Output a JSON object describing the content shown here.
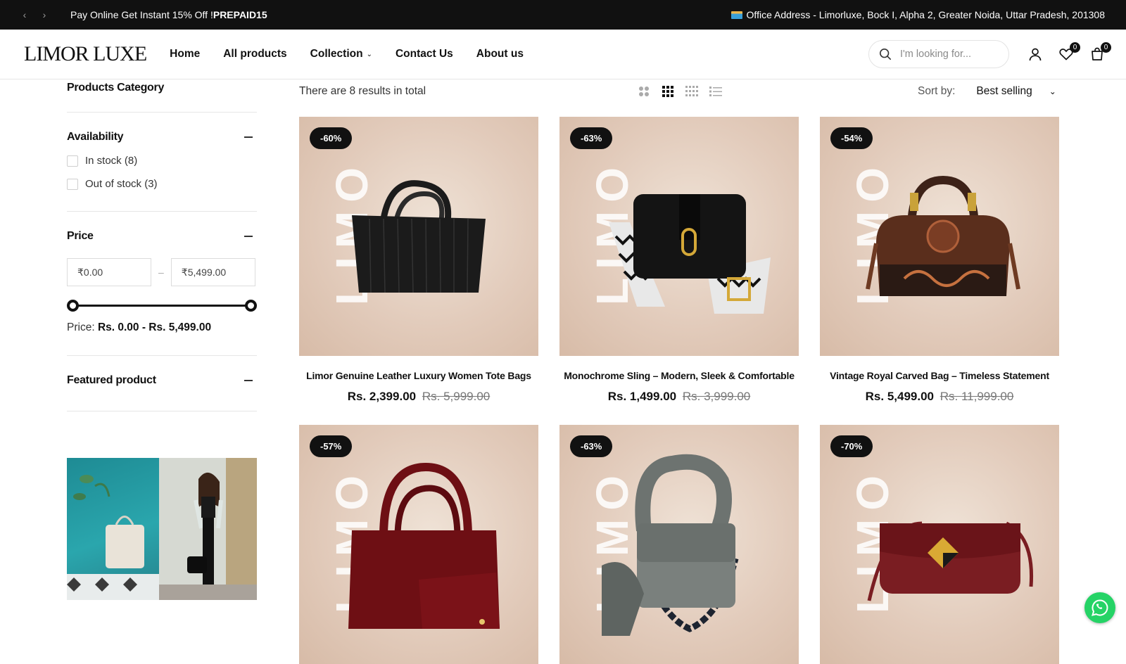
{
  "announcement": {
    "promo_text": "Pay Online Get Instant 15% Off !",
    "promo_code": "PREPAID15",
    "address": "Office Address - Limorluxe, Bock I, Alpha 2, Greater Noida, Uttar Pradesh, 201308"
  },
  "header": {
    "logo": "LIMOR LUXE",
    "nav": [
      "Home",
      "All products",
      "Collection",
      "Contact Us",
      "About us"
    ],
    "search_placeholder": "I'm looking for...",
    "wishlist_count": "0",
    "cart_count": "0"
  },
  "sidebar": {
    "category_title": "Products Category",
    "availability_title": "Availability",
    "in_stock": "In stock (8)",
    "out_of_stock": "Out of stock (3)",
    "price_title": "Price",
    "price_min": "₹0.00",
    "price_max": "₹5,499.00",
    "price_label_prefix": "Price:",
    "price_label_range": "Rs. 0.00 - Rs. 5,499.00",
    "featured_title": "Featured product"
  },
  "toolbar": {
    "results_text": "There are 8 results in total",
    "sort_label": "Sort by:",
    "sort_value": "Best selling"
  },
  "products": [
    {
      "discount": "-60%",
      "name": "Limor Genuine Leather Luxury Women Tote Bags",
      "price": "Rs. 2,399.00",
      "compare": "Rs. 5,999.00",
      "color": "#1b1b1b"
    },
    {
      "discount": "-63%",
      "name": "Monochrome Sling – Modern, Sleek & Comfortable",
      "price": "Rs. 1,499.00",
      "compare": "Rs. 3,999.00",
      "color": "#141414"
    },
    {
      "discount": "-54%",
      "name": "Vintage Royal Carved Bag – Timeless Statement",
      "price": "Rs. 5,499.00",
      "compare": "Rs. 11,999.00",
      "color": "#5a2e1c"
    },
    {
      "discount": "-57%",
      "name": "",
      "price": "",
      "compare": "",
      "color": "#6e0f14"
    },
    {
      "discount": "-63%",
      "name": "",
      "price": "",
      "compare": "",
      "color": "#6d7370"
    },
    {
      "discount": "-70%",
      "name": "",
      "price": "",
      "compare": "",
      "color": "#7a1d22"
    }
  ],
  "brand_watermark": "LIMO"
}
